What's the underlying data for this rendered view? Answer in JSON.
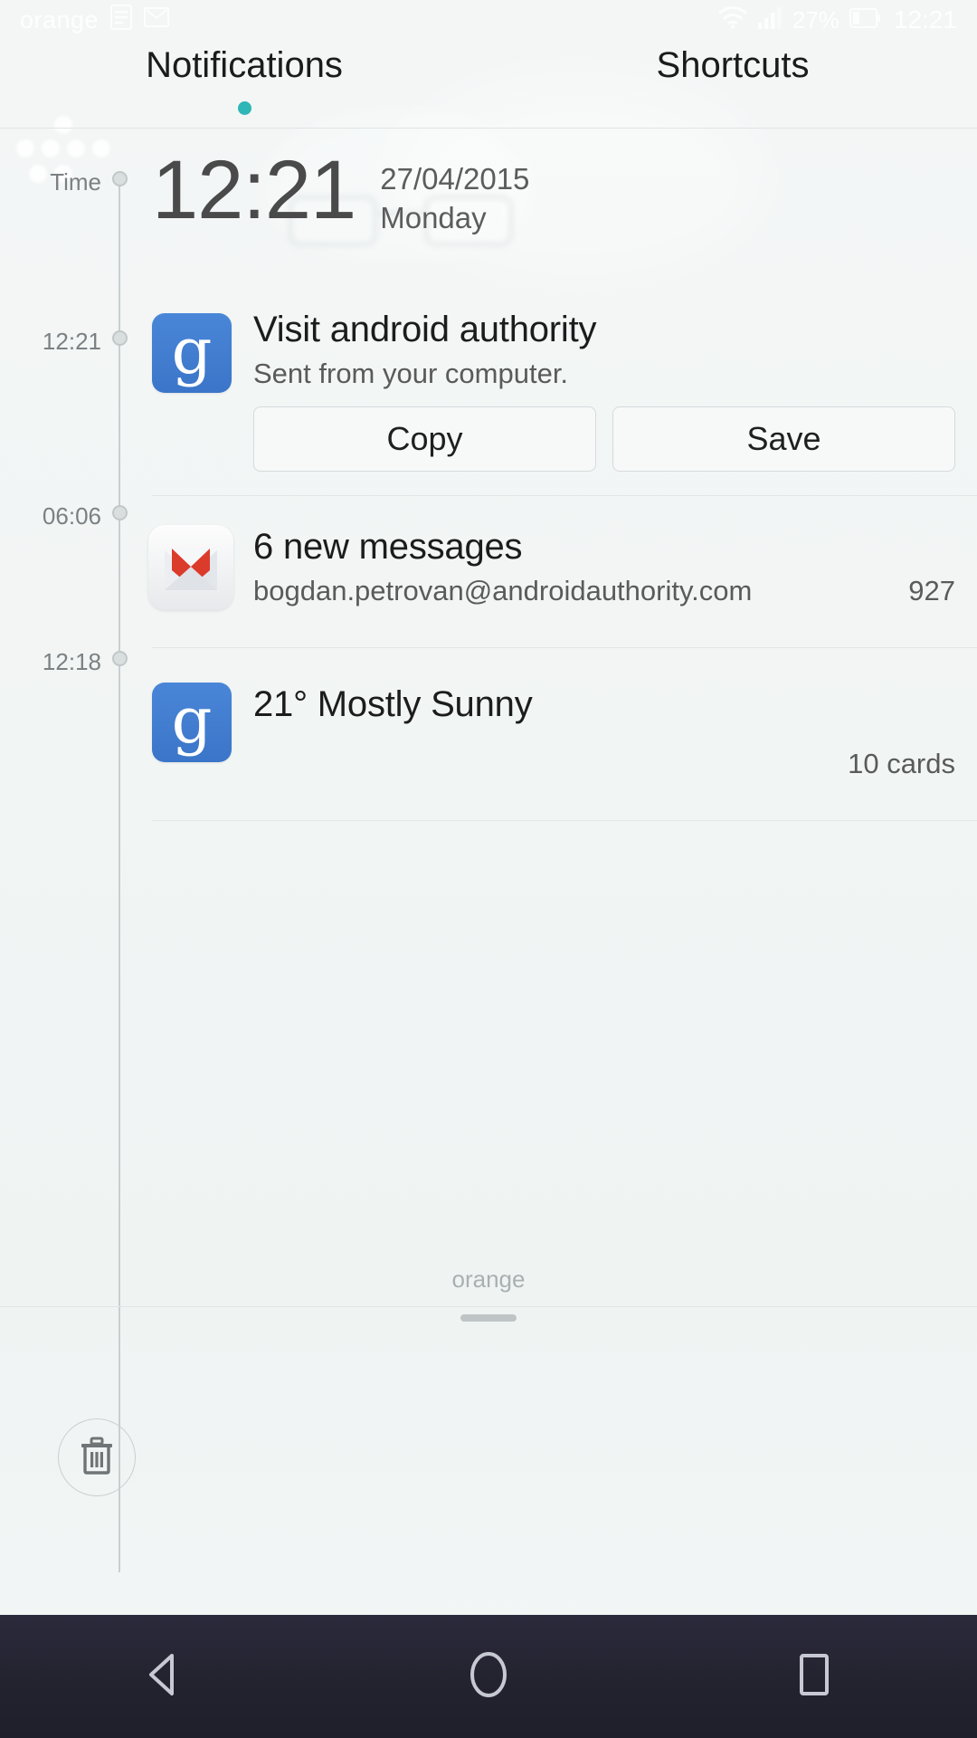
{
  "statusbar": {
    "carrier": "orange",
    "icons": [
      "notes-icon",
      "gmail-status-icon"
    ],
    "wifi_icon": "wifi-icon",
    "signal_icon": "signal-bars-icon",
    "battery_percent": "27%",
    "battery_icon": "battery-icon",
    "time": "12:21"
  },
  "tabs": [
    {
      "label": "Notifications",
      "active": true
    },
    {
      "label": "Shortcuts",
      "active": false
    }
  ],
  "accent_color": "#2fb6b6",
  "timeline": {
    "label": "Time",
    "marks": [
      "12:21",
      "06:06",
      "12:18"
    ]
  },
  "clock": {
    "time": "12:21",
    "date": "27/04/2015",
    "day": "Monday"
  },
  "notifications": [
    {
      "time": "12:21",
      "icon": "google-icon",
      "title": "Visit android authority",
      "subtitle": "Sent from your computer.",
      "actions": [
        "Copy",
        "Save"
      ]
    },
    {
      "time": "06:06",
      "icon": "gmail-icon",
      "title": "6 new messages",
      "subtitle": "bogdan.petrovan@androidauthority.com",
      "count": "927"
    },
    {
      "time": "12:18",
      "icon": "google-icon",
      "title": "21° Mostly Sunny",
      "note": "10 cards"
    }
  ],
  "clear_button": {
    "icon": "trash-icon"
  },
  "bottom": {
    "carrier": "orange",
    "drag_handle": "drag-handle"
  },
  "navbar": [
    {
      "icon": "back-icon"
    },
    {
      "icon": "home-icon"
    },
    {
      "icon": "recents-icon"
    }
  ]
}
